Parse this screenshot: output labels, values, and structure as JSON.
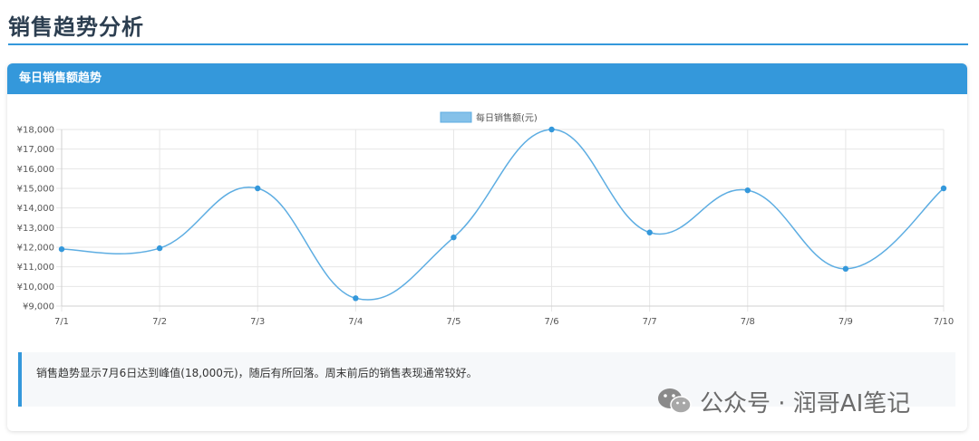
{
  "page": {
    "title": "销售趋势分析"
  },
  "card": {
    "header": "每日销售额趋势"
  },
  "chart_data": {
    "type": "line",
    "categories": [
      "7/1",
      "7/2",
      "7/3",
      "7/4",
      "7/5",
      "7/6",
      "7/7",
      "7/8",
      "7/9",
      "7/10"
    ],
    "series": [
      {
        "name": "每日销售额(元)",
        "values": [
          11900,
          11950,
          15000,
          9400,
          12500,
          18000,
          12750,
          14900,
          10900,
          15000
        ],
        "color": "#5dade2"
      }
    ],
    "y_ticks": [
      "¥9,000",
      "¥10,000",
      "¥11,000",
      "¥12,000",
      "¥13,000",
      "¥14,000",
      "¥15,000",
      "¥16,000",
      "¥17,000",
      "¥18,000"
    ],
    "ylim": [
      9000,
      18000
    ],
    "grid": true,
    "legend": "top-center",
    "smooth": true
  },
  "note": {
    "text": "销售趋势显示7月6日达到峰值(18,000元)，随后有所回落。周末前后的销售表现通常较好。"
  },
  "watermark": {
    "text": "公众号 · 润哥AI笔记"
  },
  "colors": {
    "accent": "#3498db",
    "line": "#5dade2",
    "legend_fill": "#85c1e9"
  }
}
